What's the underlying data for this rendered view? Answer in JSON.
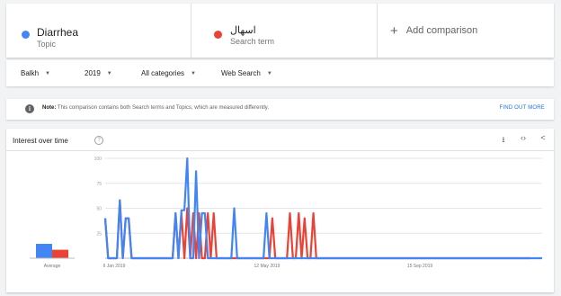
{
  "comparison": {
    "terms": [
      {
        "name": "Diarrhea",
        "type": "Topic",
        "color": "#4285f4"
      },
      {
        "name": "اسهال",
        "type": "Search term",
        "color": "#ea4335"
      }
    ],
    "add_label": "Add comparison",
    "add_icon": "plus-icon"
  },
  "filters": [
    {
      "label": "Balkh"
    },
    {
      "label": "2019"
    },
    {
      "label": "All categories"
    },
    {
      "label": "Web Search"
    }
  ],
  "note": {
    "prefix": "Note:",
    "text": "This comparison contains both Search terms and Topics, which are measured differently.",
    "link": "FIND OUT MORE",
    "icon": "info-icon"
  },
  "interest": {
    "title": "Interest over time",
    "tools": [
      "download-icon",
      "embed-icon",
      "share-icon"
    ]
  },
  "chart_data": {
    "type": "line",
    "ylim": [
      0,
      100
    ],
    "yticks": [
      "100",
      "75",
      "50",
      "25"
    ],
    "average_label": "Average",
    "x_tick_labels": [
      "6 Jan 2019",
      "12 May 2019",
      "15 Sep 2019"
    ],
    "averages": [
      17,
      10
    ],
    "series": [
      {
        "color": "#4285f4",
        "values": [
          40,
          0,
          0,
          0,
          0,
          58,
          0,
          40,
          40,
          0,
          0,
          0,
          0,
          0,
          0,
          0,
          0,
          0,
          0,
          0,
          0,
          0,
          0,
          0,
          45,
          0,
          48,
          48,
          100,
          0,
          0,
          87,
          0,
          45,
          45,
          0,
          0,
          0,
          0,
          0,
          0,
          0,
          0,
          0,
          50,
          0,
          0,
          0,
          0,
          0,
          0,
          0,
          0,
          0,
          0,
          45,
          0,
          0,
          0,
          0,
          0,
          0,
          0,
          0,
          0,
          0,
          0,
          0,
          0,
          0,
          0,
          0,
          0,
          0,
          0,
          0,
          0,
          0,
          0,
          0,
          0,
          0,
          0,
          0,
          0,
          0,
          0,
          0,
          0,
          0,
          0,
          0,
          0,
          0,
          0,
          0,
          0,
          0,
          0,
          0,
          0,
          0,
          0,
          0,
          0,
          0,
          0,
          0,
          0,
          0,
          0,
          0,
          0,
          0,
          0,
          0,
          0,
          0,
          0,
          0,
          0,
          0,
          0,
          0,
          0,
          0,
          0,
          0,
          0,
          0,
          0,
          0,
          0,
          0,
          0,
          0,
          0,
          0,
          0,
          0,
          0,
          0,
          0,
          0,
          0,
          0,
          0,
          0,
          0,
          0
        ]
      },
      {
        "color": "#ea4335",
        "values": [
          40,
          0,
          0,
          0,
          0,
          58,
          0,
          40,
          40,
          0,
          0,
          0,
          0,
          0,
          0,
          0,
          0,
          0,
          0,
          0,
          0,
          0,
          0,
          0,
          45,
          0,
          45,
          0,
          50,
          0,
          45,
          0,
          45,
          0,
          0,
          45,
          0,
          45,
          0,
          0,
          0,
          0,
          0,
          0,
          0,
          0,
          0,
          0,
          0,
          0,
          0,
          0,
          0,
          0,
          0,
          0,
          0,
          40,
          0,
          0,
          0,
          0,
          0,
          45,
          0,
          0,
          45,
          0,
          40,
          0,
          0,
          45,
          0,
          0,
          0,
          0,
          0,
          0,
          0,
          0,
          0,
          0,
          0,
          0,
          0,
          0,
          0,
          0,
          0,
          0,
          0,
          0,
          0,
          0,
          0,
          0,
          0,
          0,
          0,
          0,
          0,
          0,
          0,
          0,
          0,
          0,
          0,
          0,
          0,
          0,
          0,
          0,
          0,
          0,
          0,
          0,
          0,
          0,
          0,
          0,
          0,
          0,
          0,
          0,
          0,
          0,
          0,
          0,
          0,
          0,
          0,
          0,
          0,
          0,
          0,
          0,
          0,
          0,
          0,
          0,
          0,
          0,
          0,
          0,
          0,
          0
        ]
      }
    ]
  }
}
